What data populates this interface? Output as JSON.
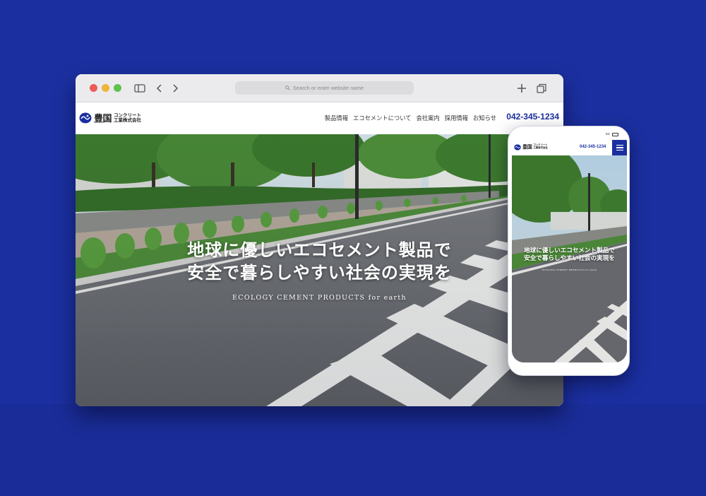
{
  "colors": {
    "background": "#1b2fa0",
    "brand": "#1b2fa0",
    "road": "#6a6c70",
    "vegetation": "#3f8a35"
  },
  "browser": {
    "address_placeholder": "Search or enter website name",
    "icons": [
      "sidebar-icon",
      "back-arrow-icon",
      "forward-arrow-icon",
      "search-icon",
      "plus-icon",
      "tabs-icon"
    ]
  },
  "site": {
    "logo": {
      "main": "豊国",
      "sub_top": "コンクリート",
      "sub_bottom": "工業株式会社"
    },
    "nav": [
      {
        "label": "製品情報"
      },
      {
        "label": "エコセメントについて"
      },
      {
        "label": "会社案内"
      },
      {
        "label": "採用情報"
      },
      {
        "label": "お知らせ"
      }
    ],
    "phone": "042-345-1234",
    "hero": {
      "line1": "地球に優しいエコセメント製品で",
      "line2": "安全で暮らしやすい社会の実現を",
      "tagline": "ECOLOGY CEMENT PRODUCTS for earth"
    }
  },
  "mobile": {
    "status": "5G",
    "menu_icon": "hamburger-icon"
  }
}
